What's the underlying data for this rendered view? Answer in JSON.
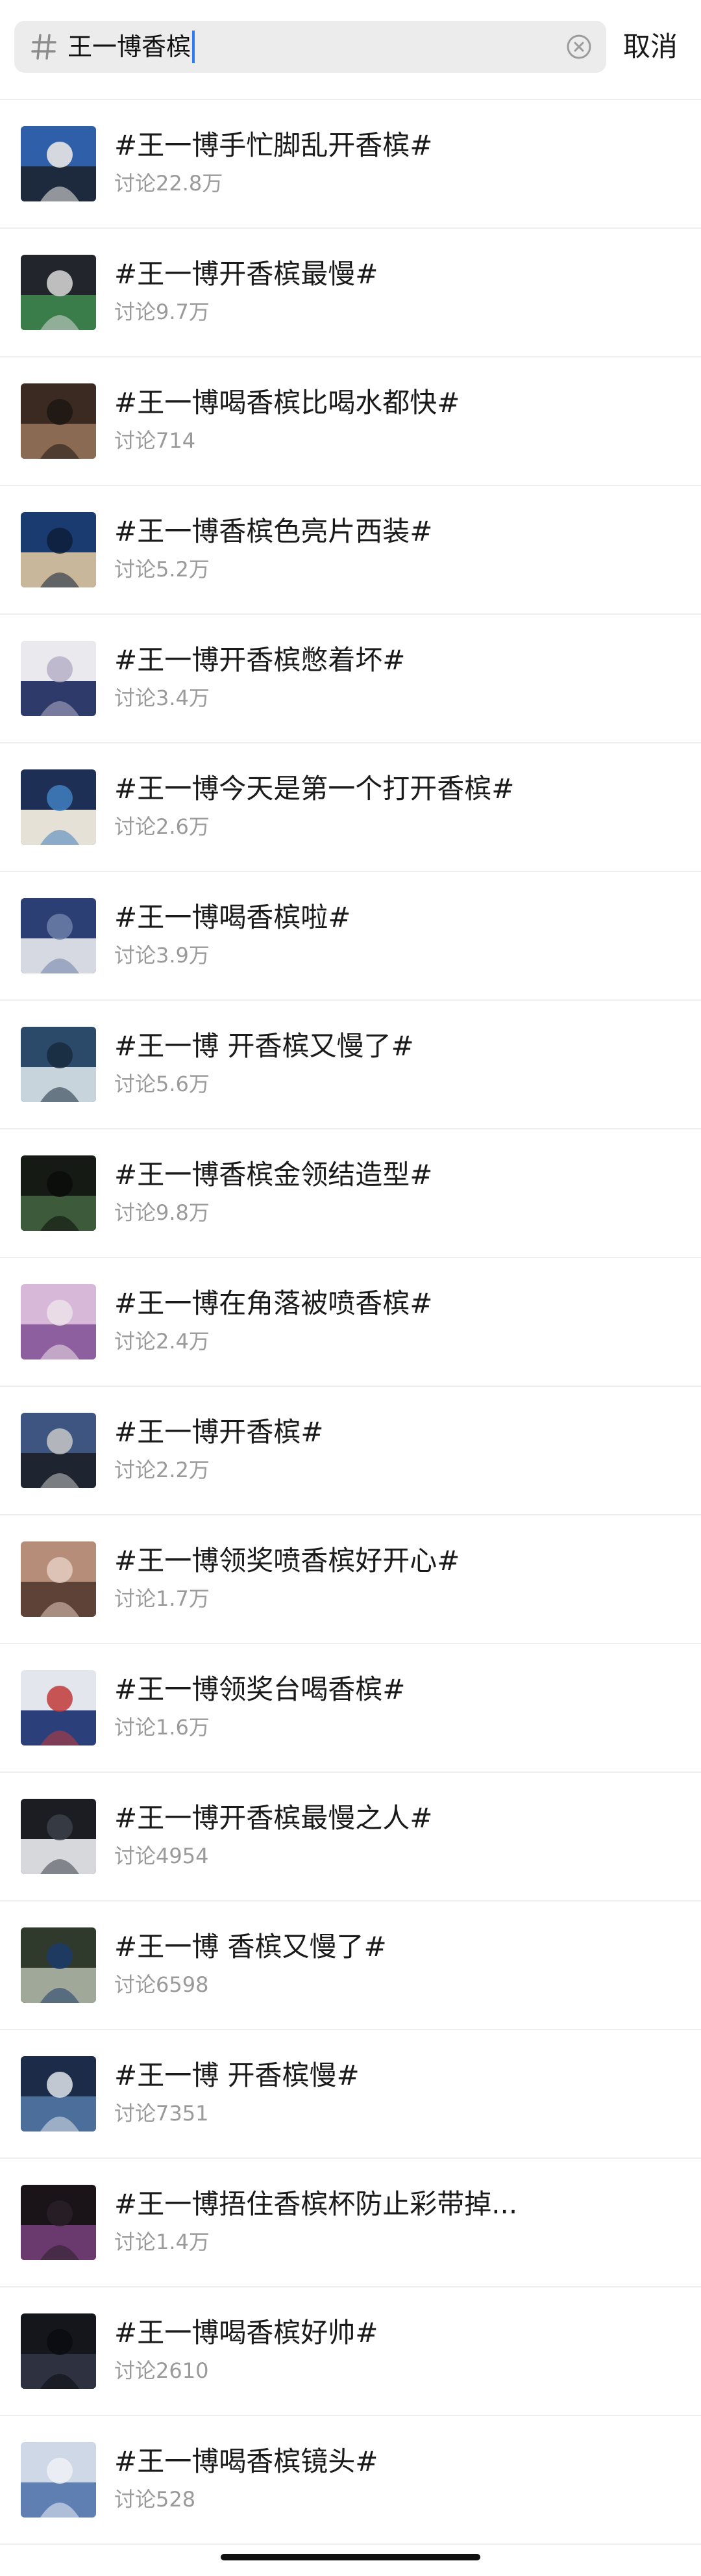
{
  "search": {
    "query": "王一博香槟",
    "hash_icon": "hash-icon",
    "clear_icon": "clear-icon",
    "cancel_label": "取消"
  },
  "results": [
    {
      "title": "#王一博手忙脚乱开香槟#",
      "count": "讨论22.8万",
      "thumb_colors": [
        "#2f5fa8",
        "#1d2a3d",
        "#f2efe9"
      ]
    },
    {
      "title": "#王一博开香槟最慢#",
      "count": "讨论9.7万",
      "thumb_colors": [
        "#22252b",
        "#3a7d4a",
        "#d9d9d9"
      ]
    },
    {
      "title": "#王一博喝香槟比喝水都快#",
      "count": "讨论714",
      "thumb_colors": [
        "#3b2a22",
        "#8a6a52",
        "#1c1612"
      ]
    },
    {
      "title": "#王一博香槟色亮片西装#",
      "count": "讨论5.2万",
      "thumb_colors": [
        "#1a3b70",
        "#c8b79a",
        "#0e1f3a"
      ]
    },
    {
      "title": "#王一博开香槟憋着坏#",
      "count": "讨论3.4万",
      "thumb_colors": [
        "#e9e9ee",
        "#2e3a6a",
        "#b7b0c8"
      ]
    },
    {
      "title": "#王一博今天是第一个打开香槟#",
      "count": "讨论2.6万",
      "thumb_colors": [
        "#1d2f55",
        "#e6e1d6",
        "#3f7fbf"
      ]
    },
    {
      "title": "#王一博喝香槟啦#",
      "count": "讨论3.9万",
      "thumb_colors": [
        "#2b3f74",
        "#d7d9e2",
        "#6b7fa8"
      ]
    },
    {
      "title": "#王一博 开香槟又慢了#",
      "count": "讨论5.6万",
      "thumb_colors": [
        "#2b4a6a",
        "#c7d4dc",
        "#17293d"
      ]
    },
    {
      "title": "#王一博香槟金领结造型#",
      "count": "讨论9.8万",
      "thumb_colors": [
        "#151a14",
        "#3d5a3a",
        "#0b0d0a"
      ]
    },
    {
      "title": "#王一博在角落被喷香槟#",
      "count": "讨论2.4万",
      "thumb_colors": [
        "#d8b8d8",
        "#8e5f9e",
        "#ece2ea"
      ]
    },
    {
      "title": "#王一博开香槟#",
      "count": "讨论2.2万",
      "thumb_colors": [
        "#3d5580",
        "#1e2430",
        "#c7c7c7"
      ]
    },
    {
      "title": "#王一博领奖喷香槟好开心#",
      "count": "讨论1.7万",
      "thumb_colors": [
        "#b58d78",
        "#5e4137",
        "#e3cdbf"
      ]
    },
    {
      "title": "#王一博领奖台喝香槟#",
      "count": "讨论1.6万",
      "thumb_colors": [
        "#e4e6ee",
        "#2b3f7a",
        "#c23a3a"
      ]
    },
    {
      "title": "#王一博开香槟最慢之人#",
      "count": "讨论4954",
      "thumb_colors": [
        "#1b1d22",
        "#d7d8dc",
        "#3b3f48"
      ]
    },
    {
      "title": "#王一博 香槟又慢了#",
      "count": "讨论6598",
      "thumb_colors": [
        "#2f3a2c",
        "#a0a89a",
        "#1c3b6a"
      ]
    },
    {
      "title": "#王一博 开香槟慢#",
      "count": "讨论7351",
      "thumb_colors": [
        "#1c2c48",
        "#4b6e9a",
        "#dfe4ea"
      ]
    },
    {
      "title": "#王一博捂住香槟杯防止彩带掉...",
      "count": "讨论1.4万",
      "thumb_colors": [
        "#1a1418",
        "#6a3a6e",
        "#2a1f28"
      ]
    },
    {
      "title": "#王一博喝香槟好帅#",
      "count": "讨论2610",
      "thumb_colors": [
        "#14161c",
        "#2d3140",
        "#0b0c10"
      ]
    },
    {
      "title": "#王一博喝香槟镜头#",
      "count": "讨论528",
      "thumb_colors": [
        "#cfd8e6",
        "#5f7fb3",
        "#eef1f5"
      ]
    }
  ]
}
